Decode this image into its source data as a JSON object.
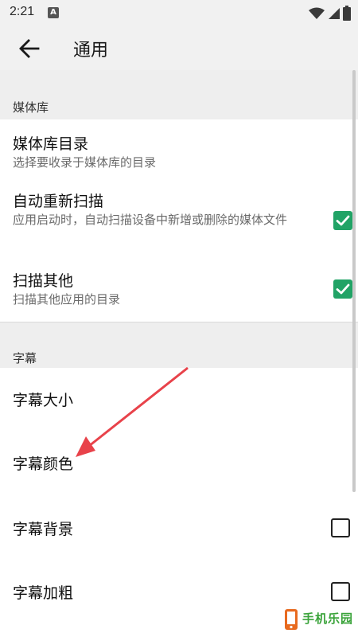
{
  "status_bar": {
    "time": "2:21",
    "notification_badge": "A"
  },
  "app_bar": {
    "title": "通用"
  },
  "sections": {
    "media_library": {
      "header": "媒体库",
      "items": [
        {
          "title": "媒体库目录",
          "subtitle": "选择要收录于媒体库的目录"
        },
        {
          "title": "自动重新扫描",
          "subtitle": "应用启动时，自动扫描设备中新增或删除的媒体文件",
          "checked": true
        },
        {
          "title": "扫描其他",
          "subtitle": "扫描其他应用的目录",
          "checked": true
        }
      ]
    },
    "subtitles": {
      "header": "字幕",
      "items": [
        {
          "title": "字幕大小"
        },
        {
          "title": "字幕颜色"
        },
        {
          "title": "字幕背景",
          "checked": false
        },
        {
          "title": "字幕加粗",
          "checked": false
        }
      ]
    }
  },
  "watermark": {
    "text": "手机乐园"
  },
  "colors": {
    "checkbox_checked": "#21a366",
    "annotation_arrow": "#e8424a",
    "section_background": "#eeeeee"
  }
}
